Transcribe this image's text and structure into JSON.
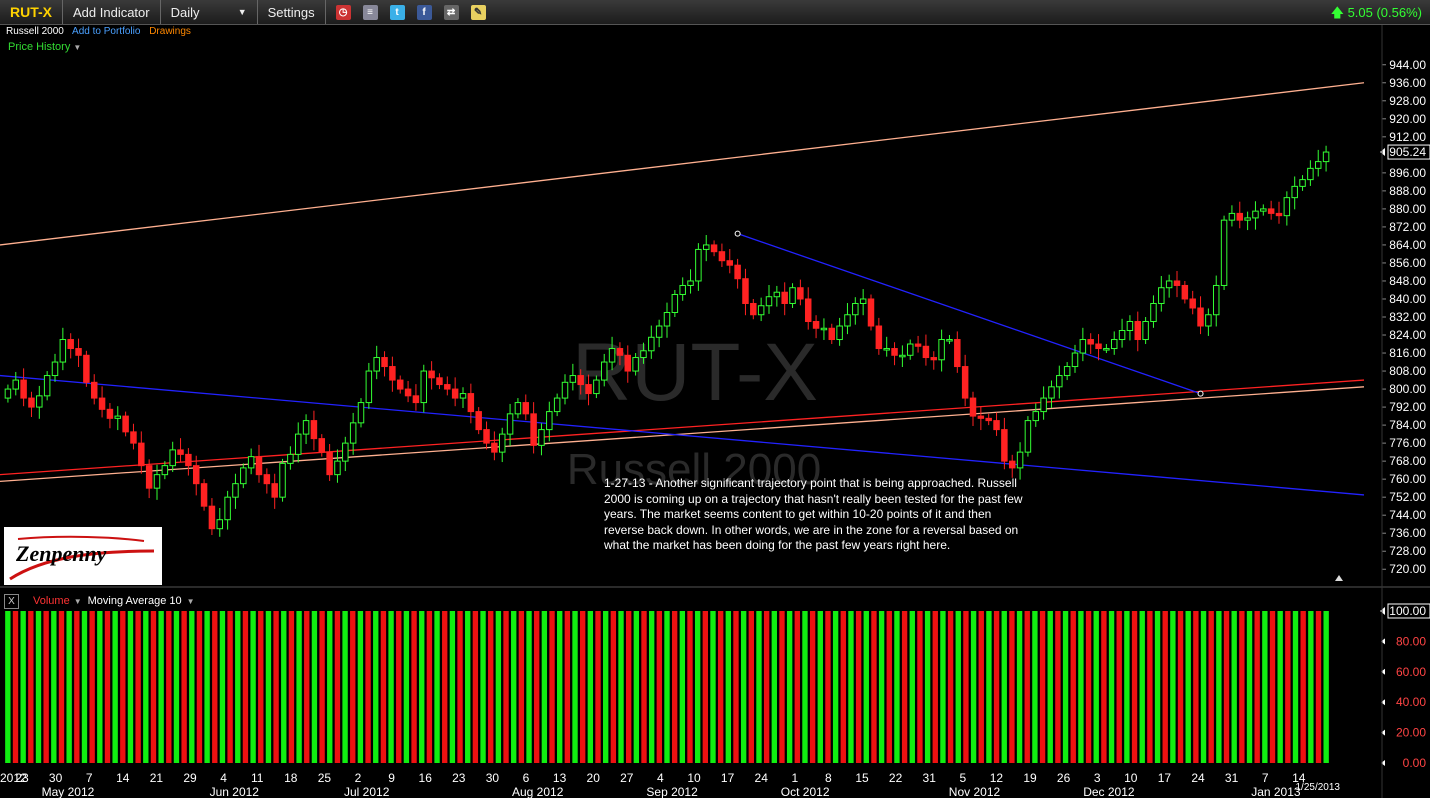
{
  "toolbar": {
    "symbol": "RUT-X",
    "add_indicator": "Add Indicator",
    "interval": "Daily",
    "settings": "Settings",
    "icons": [
      "alarm-clock-icon",
      "watchlist-icon",
      "twitter-icon",
      "facebook-icon",
      "share-icon",
      "notes-icon"
    ]
  },
  "quote": {
    "change": "5.05 (0.56%)",
    "direction": "up"
  },
  "subbar": {
    "name": "Russell 2000",
    "add_portfolio": "Add to Portfolio",
    "drawings": "Drawings"
  },
  "panel": {
    "price_history": "Price History"
  },
  "watermark": {
    "symbol": "RUT-X",
    "name": "Russell 2000"
  },
  "note": "1-27-13 - Another significant trajectory point that is being approached. Russell 2000 is coming up on a trajectory that hasn't really been tested for the past few years. The market seems content to get within 10-20 points of it and then reverse back down. In other words, we are in the zone for a reversal based on what the market has been doing for the past few years right here.",
  "logo": {
    "text": "Zenpenny"
  },
  "volume_panel": {
    "label": "Volume",
    "ma": "Moving Average 10"
  },
  "colors": {
    "up": "#33ff33",
    "down": "#ff2222",
    "trend_blue": "#2222ff",
    "trend_red": "#ff2222",
    "trend_salmon": "#ffb090",
    "volume_green": "#11ee11",
    "volume_red": "#ee1111"
  },
  "chart_data": {
    "type": "candlestick",
    "y_axis": {
      "ticks": [
        "944.00",
        "936.00",
        "928.00",
        "920.00",
        "912.00",
        "905.24",
        "896.00",
        "888.00",
        "880.00",
        "872.00",
        "864.00",
        "856.00",
        "848.00",
        "840.00",
        "832.00",
        "824.00",
        "816.00",
        "808.00",
        "800.00",
        "792.00",
        "784.00",
        "776.00",
        "768.00",
        "760.00",
        "752.00",
        "744.00",
        "736.00",
        "728.00",
        "720.00"
      ],
      "last_price": "905.24",
      "ylim": [
        717,
        947
      ]
    },
    "volume_axis": {
      "ticks": [
        "100.00",
        "80.00",
        "60.00",
        "40.00",
        "20.00",
        "0.00"
      ],
      "ylim": [
        0,
        100
      ]
    },
    "x_axis": {
      "day_ticks": [
        "2012",
        "23",
        "30",
        "7",
        "14",
        "21",
        "29",
        "4",
        "11",
        "18",
        "25",
        "2",
        "9",
        "16",
        "23",
        "30",
        "6",
        "13",
        "20",
        "27",
        "4",
        "10",
        "17",
        "24",
        "1",
        "8",
        "15",
        "22",
        "31",
        "5",
        "12",
        "19",
        "26",
        "3",
        "10",
        "17",
        "24",
        "31",
        "7",
        "14"
      ],
      "month_labels": [
        "May 2012",
        "Jun 2012",
        "Jul 2012",
        "Aug 2012",
        "Sep 2012",
        "Oct 2012",
        "Nov 2012",
        "Dec 2012",
        "Jan 2013"
      ],
      "end_date": "1/25/2013"
    },
    "closes": [
      800,
      804,
      796,
      792,
      797,
      806,
      812,
      822,
      818,
      815,
      803,
      796,
      791,
      787,
      788,
      781,
      776,
      766,
      756,
      762,
      766,
      773,
      771,
      766,
      758,
      748,
      738,
      742,
      752,
      758,
      765,
      770,
      762,
      758,
      752,
      767,
      771,
      780,
      786,
      778,
      772,
      762,
      768,
      776,
      785,
      794,
      808,
      814,
      810,
      804,
      800,
      797,
      794,
      808,
      805,
      802,
      800,
      796,
      798,
      790,
      782,
      776,
      772,
      780,
      789,
      794,
      789,
      775,
      782,
      790,
      796,
      803,
      806,
      802,
      798,
      804,
      812,
      818,
      815,
      808,
      814,
      817,
      823,
      828,
      834,
      842,
      846,
      848,
      862,
      864,
      861,
      857,
      855,
      849,
      838,
      833,
      837,
      841,
      843,
      838,
      845,
      840,
      830,
      827,
      827,
      822,
      828,
      833,
      838,
      840,
      828,
      818,
      818,
      815,
      815,
      820,
      819,
      814,
      813,
      822,
      822,
      810,
      796,
      788,
      787,
      786,
      782,
      768,
      765,
      772,
      786,
      790,
      796,
      801,
      806,
      810,
      816,
      822,
      820,
      818,
      818,
      822,
      826,
      830,
      822,
      830,
      838,
      845,
      848,
      846,
      840,
      836,
      828,
      833,
      846,
      875,
      878,
      875,
      876,
      879,
      880,
      878,
      877,
      885,
      890,
      893,
      898,
      901,
      905.24
    ],
    "trendlines": [
      {
        "name": "upper-salmon",
        "from": {
          "bar": 0,
          "price": 864
        },
        "to": {
          "bar": 175,
          "price": 936
        }
      },
      {
        "name": "lower-red",
        "from": {
          "bar": 0,
          "price": 762
        },
        "to": {
          "bar": 175,
          "price": 804
        }
      },
      {
        "name": "lower-salmon",
        "from": {
          "bar": 0,
          "price": 759
        },
        "to": {
          "bar": 175,
          "price": 801
        }
      },
      {
        "name": "falling-blue",
        "from": {
          "bar": 0,
          "price": 806
        },
        "to": {
          "bar": 175,
          "price": 753
        }
      },
      {
        "name": "short-blue",
        "from": {
          "bar": 93,
          "price": 869
        },
        "to": {
          "bar": 152,
          "price": 798
        }
      }
    ],
    "volume": {
      "bars": 173,
      "pattern": "alternating-up-down"
    }
  }
}
